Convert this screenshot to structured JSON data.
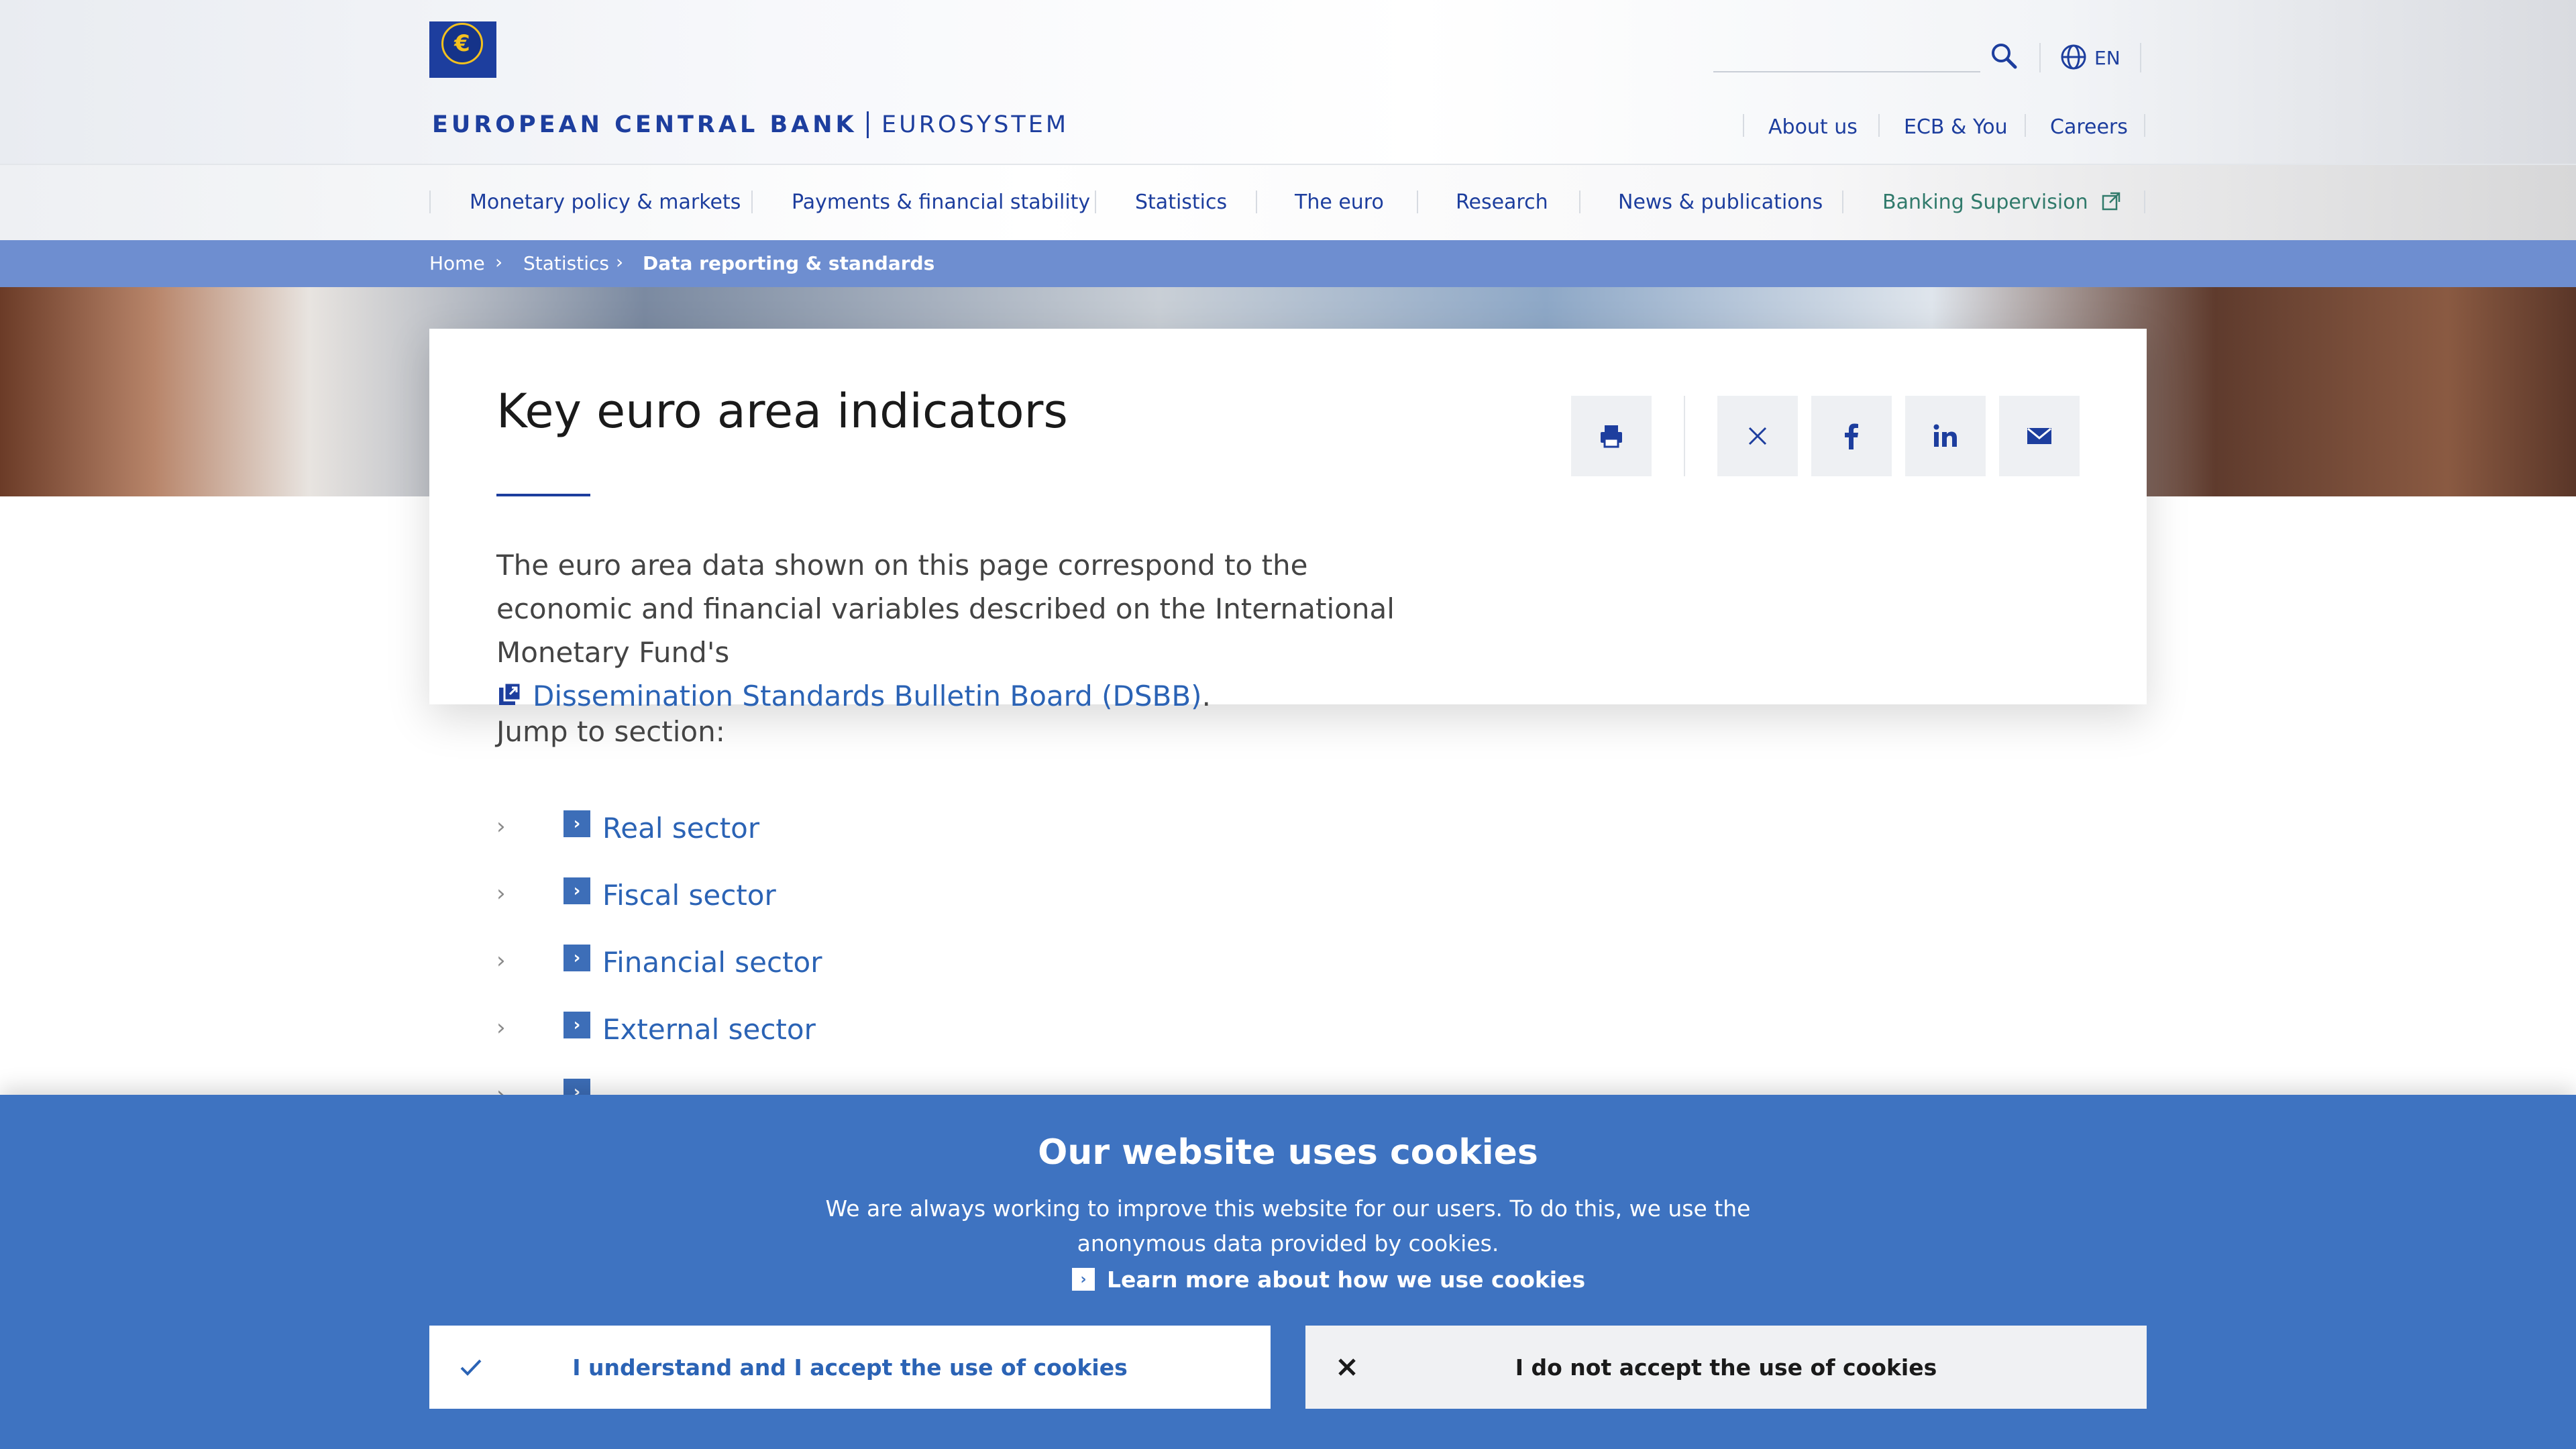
{
  "header": {
    "bank_name": "EUROPEAN CENTRAL BANK",
    "system_name": "EUROSYSTEM",
    "logo_symbol": "€",
    "language": "EN",
    "top_links": [
      "About us",
      "ECB & You",
      "Careers"
    ]
  },
  "nav": {
    "items": [
      "Monetary policy & markets",
      "Payments & financial stability",
      "Statistics",
      "The euro",
      "Research",
      "News & publications",
      "Banking Supervision"
    ]
  },
  "breadcrumb": {
    "items": [
      "Home",
      "Statistics",
      "Data reporting & standards"
    ]
  },
  "main": {
    "title": "Key euro area indicators",
    "intro_text": "The euro area data shown on this page correspond to the economic and financial variables described on the International Monetary Fund's",
    "intro_link": "Dissemination Standards Bulletin Board (DSBB)",
    "intro_end": ".",
    "jump_label": "Jump to section:",
    "sections": [
      "Real sector",
      "Fiscal sector",
      "Financial sector",
      "External sector"
    ]
  },
  "share": {
    "buttons": [
      "print-icon",
      "x-icon",
      "facebook-icon",
      "linkedin-icon",
      "email-icon"
    ]
  },
  "cookie": {
    "title": "Our website uses cookies",
    "text": "We are always working to improve this website for our users. To do this, we use the anonymous data provided by cookies.",
    "learn_more": "Learn more about how we use cookies",
    "accept": "I understand and I accept the use of cookies",
    "decline": "I do not accept the use of cookies"
  },
  "colors": {
    "brand": "#1d3e9e",
    "link": "#2b63b5",
    "cookie_bg": "#3e73c1",
    "breadcrumb_bg": "#6e8ed0",
    "supervision": "#307a6b"
  }
}
